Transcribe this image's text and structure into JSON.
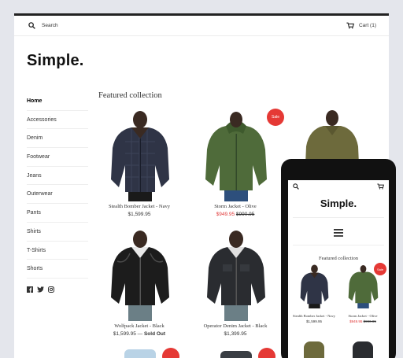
{
  "header": {
    "search_label": "Search",
    "cart_label": "Cart (1)"
  },
  "store": {
    "logo": "Simple."
  },
  "sidebar": {
    "items": [
      {
        "label": "Home",
        "active": true
      },
      {
        "label": "Accessories"
      },
      {
        "label": "Denim"
      },
      {
        "label": "Footwear"
      },
      {
        "label": "Jeans"
      },
      {
        "label": "Outerwear"
      },
      {
        "label": "Pants"
      },
      {
        "label": "Shirts"
      },
      {
        "label": "T-Shirts"
      },
      {
        "label": "Shorts"
      }
    ]
  },
  "collection": {
    "title": "Featured collection",
    "products": [
      {
        "name": "Stealth Bomber Jacket - Navy",
        "price": "$1,599.95"
      },
      {
        "name": "Storm Jacket - Olive",
        "sale_price": "$949.95",
        "compare_price": "$990.95",
        "badge": "Sale"
      },
      {
        "name": "Wolfpack Jacket - Black",
        "price": "$1,599.95 —",
        "status": "Sold Out"
      },
      {
        "name": "Operator Denim Jacket - Black",
        "price": "$1,399.95"
      }
    ]
  },
  "mobile": {
    "logo": "Simple.",
    "collection_title": "Featured collection",
    "products": [
      {
        "name": "Stealth Bomber Jacket - Navy",
        "price": "$1,599.95"
      },
      {
        "name": "Storm Jacket - Olive",
        "sale_price": "$949.95",
        "compare_price": "$990.95",
        "badge": "Sale"
      }
    ]
  },
  "colors": {
    "accent_red": "#e53935",
    "sale_text": "#e03a3a",
    "navy_jacket": "#2f3446",
    "olive_jacket": "#4f6b3a",
    "khaki_shirt": "#6d6a3c",
    "black_leather": "#1c1c1c",
    "black_denim": "#2a2c30"
  }
}
